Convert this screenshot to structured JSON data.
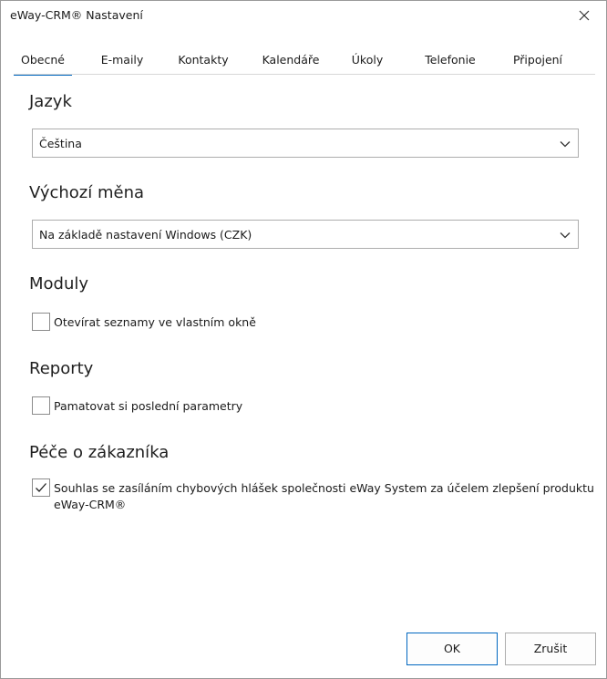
{
  "window": {
    "title": "eWay-CRM® Nastavení"
  },
  "tabs": [
    {
      "label": "Obecné",
      "active": true
    },
    {
      "label": "E-maily"
    },
    {
      "label": "Kontakty"
    },
    {
      "label": "Kalendáře"
    },
    {
      "label": "Úkoly"
    },
    {
      "label": "Telefonie"
    },
    {
      "label": "Připojení"
    }
  ],
  "language": {
    "heading": "Jazyk",
    "selected": "Čeština"
  },
  "currency": {
    "heading": "Výchozí měna",
    "selected": "Na základě nastavení Windows (CZK)"
  },
  "modules": {
    "heading": "Moduly",
    "option_label": "Otevírat seznamy ve vlastním okně",
    "checked": false
  },
  "reports": {
    "heading": "Reporty",
    "option_label": "Pamatovat si poslední parametry",
    "checked": false
  },
  "customer_care": {
    "heading": "Péče o zákazníka",
    "option_line1": "Souhlas se zasíláním chybových hlášek společnosti eWay System za účelem zlepšení produktu",
    "option_line2": "eWay-CRM®",
    "checked": true
  },
  "footer": {
    "ok_label": "OK",
    "cancel_label": "Zrušit"
  },
  "colors": {
    "accent": "#0067c0",
    "border": "#adadad"
  }
}
